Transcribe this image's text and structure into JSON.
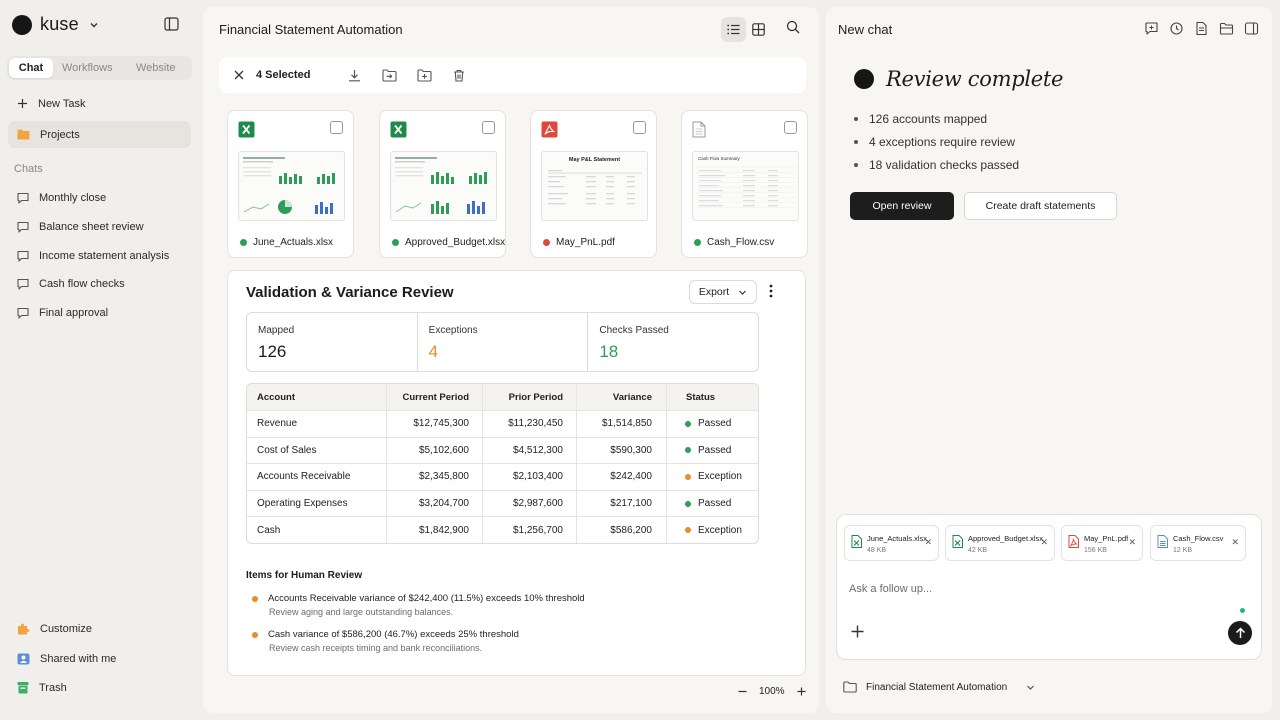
{
  "brand": {
    "name": "kuse"
  },
  "sidebar": {
    "tabs": [
      {
        "label": "Chat",
        "active": true
      },
      {
        "label": "Workflows",
        "active": false
      },
      {
        "label": "Website",
        "active": false
      }
    ],
    "new_task": "New Task",
    "projects": "Projects",
    "chats_heading": "Chats",
    "chats": [
      "Monthly close",
      "Balance sheet review",
      "Income statement analysis",
      "Cash flow checks",
      "Final approval"
    ],
    "bottom": [
      {
        "label": "Customize",
        "icon": "puzzle-icon"
      },
      {
        "label": "Shared with me",
        "icon": "shared-folder-icon"
      },
      {
        "label": "Trash",
        "icon": "trash-icon"
      }
    ]
  },
  "main": {
    "title": "Financial Statement Automation",
    "selection": {
      "count_label": "4 Selected"
    },
    "files": [
      {
        "name": "June_Actuals.xlsx",
        "type": "xlsx",
        "status_color": "#2e9d57"
      },
      {
        "name": "Approved_Budget.xlsx",
        "type": "xlsx",
        "status_color": "#2e9d57"
      },
      {
        "name": "May_PnL.pdf",
        "type": "pdf",
        "status_color": "#e0473d",
        "thumb_title": "May P&L Statement"
      },
      {
        "name": "Cash_Flow.csv",
        "type": "csv",
        "status_color": "#2e9d57",
        "thumb_title": "Cash Flow Summary"
      }
    ],
    "review": {
      "title": "Validation & Variance Review",
      "export_label": "Export",
      "stats": [
        {
          "label": "Mapped",
          "value": "126",
          "tone": "default"
        },
        {
          "label": "Exceptions",
          "value": "4",
          "tone": "orange"
        },
        {
          "label": "Checks Passed",
          "value": "18",
          "tone": "green"
        }
      ],
      "table": {
        "headers": [
          "Account",
          "Current Period",
          "Prior Period",
          "Variance",
          "Status"
        ],
        "rows": [
          {
            "account": "Revenue",
            "current": "$12,745,300",
            "prior": "$11,230,450",
            "variance": "$1,514,850",
            "status": "Passed"
          },
          {
            "account": "Cost of Sales",
            "current": "$5,102,600",
            "prior": "$4,512,300",
            "variance": "$590,300",
            "status": "Passed"
          },
          {
            "account": "Accounts Receivable",
            "current": "$2,345,800",
            "prior": "$2,103,400",
            "variance": "$242,400",
            "status": "Exception"
          },
          {
            "account": "Operating Expenses",
            "current": "$3,204,700",
            "prior": "$2,987,600",
            "variance": "$217,100",
            "status": "Passed"
          },
          {
            "account": "Cash",
            "current": "$1,842,900",
            "prior": "$1,256,700",
            "variance": "$586,200",
            "status": "Exception"
          }
        ]
      },
      "items_title": "Items for Human Review",
      "items": [
        {
          "main": "Accounts Receivable variance of $242,400 (11.5%) exceeds 10% threshold",
          "sub": "Review aging and large outstanding balances."
        },
        {
          "main": "Cash variance of $586,200 (46.7%) exceeds 25% threshold",
          "sub": "Review cash receipts timing and bank reconciliations."
        }
      ]
    },
    "zoom": "100%",
    "colors": {
      "passed": "#2e9d57",
      "exception": "#ee8a2e"
    }
  },
  "chat": {
    "title": "New chat",
    "result_title": "Review complete",
    "bullets": [
      "126 accounts mapped",
      "4 exceptions require review",
      "18 validation checks passed"
    ],
    "primary_action": "Open review",
    "secondary_action": "Create draft statements",
    "attachments": [
      {
        "name": "June_Actuals.xlsx",
        "size": "48 KB",
        "type": "xlsx"
      },
      {
        "name": "Approved_Budget.xlsx",
        "size": "42 KB",
        "type": "xlsx"
      },
      {
        "name": "May_PnL.pdf",
        "size": "156 KB",
        "type": "pdf"
      },
      {
        "name": "Cash_Flow.csv",
        "size": "12 KB",
        "type": "csv"
      }
    ],
    "input_placeholder": "Ask a follow up...",
    "project": "Financial Statement Automation"
  }
}
